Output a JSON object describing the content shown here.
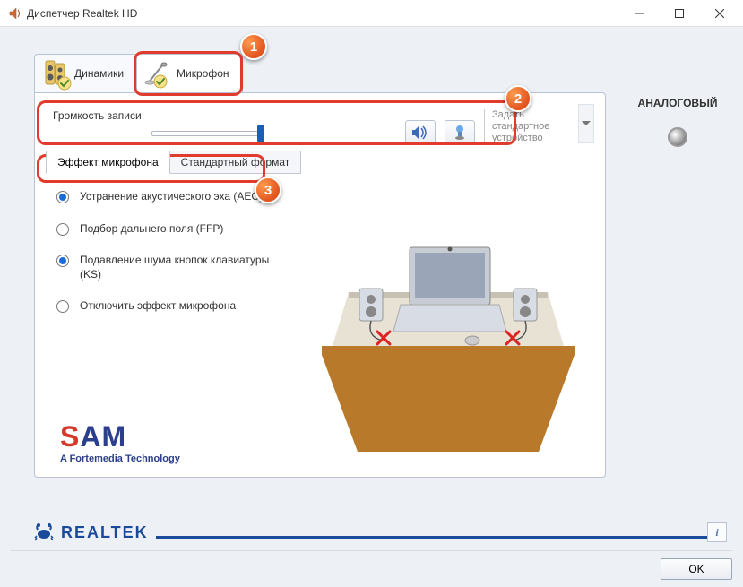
{
  "titlebar": {
    "title": "Диспетчер Realtek HD"
  },
  "tabs": {
    "speakers": "Динамики",
    "microphone": "Микрофон"
  },
  "volume": {
    "label": "Громкость записи",
    "percent": 100
  },
  "default_device": {
    "text": "Задать стандартное устройство"
  },
  "subtabs": {
    "effect": "Эффект микрофона",
    "format": "Стандартный формат"
  },
  "effects": [
    {
      "label": "Устранение акустического эха (AEC)",
      "checked": true
    },
    {
      "label": "Подбор дальнего поля (FFP)",
      "checked": false
    },
    {
      "label": "Подавление шума кнопок клавиатуры (KS)",
      "checked": true
    },
    {
      "label": "Отключить эффект микрофона",
      "checked": false
    }
  ],
  "sam": {
    "brand_s": "S",
    "brand_am": "AM",
    "subtitle": "A Fortemedia Technology"
  },
  "sidebar": {
    "title": "АНАЛОГОВЫЙ"
  },
  "footer": {
    "realtek": "REALTEK",
    "info_icon": "i"
  },
  "buttons": {
    "ok": "OK"
  },
  "callouts": {
    "one": "1",
    "two": "2",
    "three": "3"
  }
}
